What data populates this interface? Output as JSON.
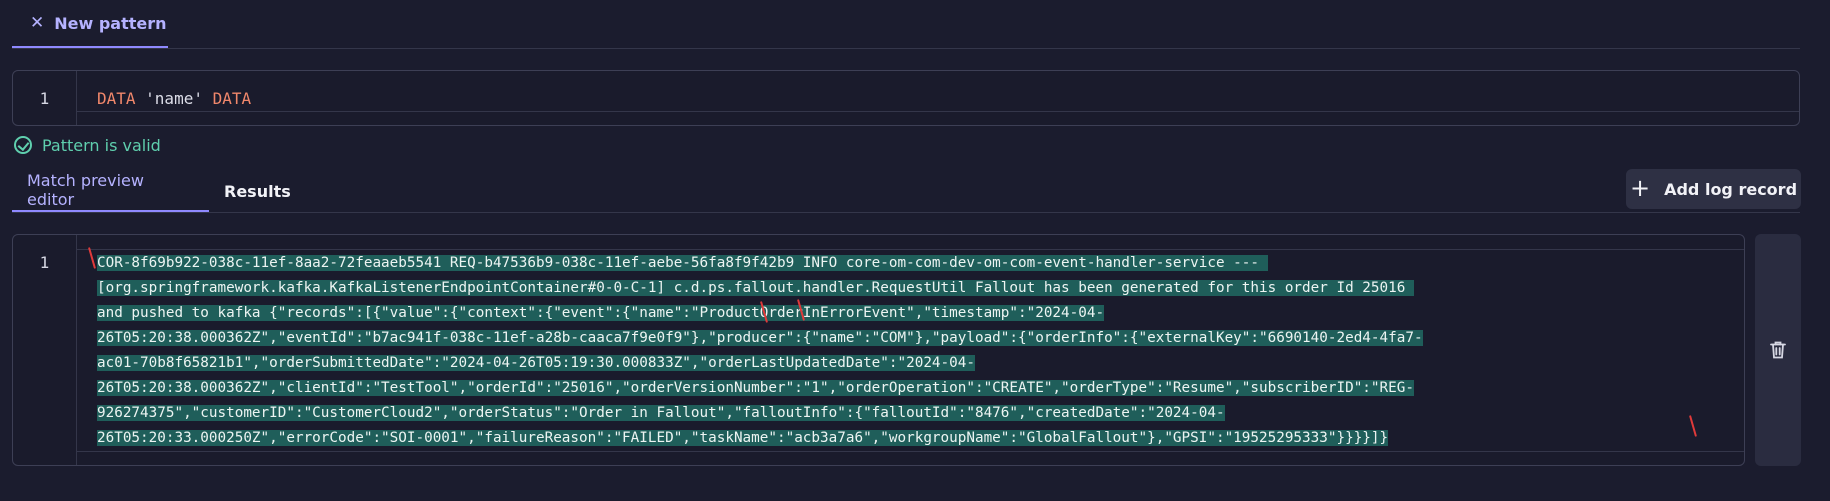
{
  "top_tab": {
    "label": "New pattern"
  },
  "pattern_editor": {
    "line_number": "1",
    "tokens": [
      "DATA",
      " 'name' ",
      "DATA"
    ]
  },
  "status": {
    "text": "Pattern is valid"
  },
  "tabs": [
    {
      "label": "Match preview editor",
      "active": true
    },
    {
      "label": "Results",
      "active": false
    }
  ],
  "add_log_record": {
    "label": "Add log record"
  },
  "log_editor": {
    "line_number": "1",
    "lines": [
      "COR-8f69b922-038c-11ef-8aa2-72feaaeb5541 REQ-b47536b9-038c-11ef-aebe-56fa8f9f42b9 INFO core-om-com-dev-om-com-event-handler-service --- ",
      "[org.springframework.kafka.KafkaListenerEndpointContainer#0-0-C-1] c.d.ps.fallout.handler.RequestUtil Fallout has been generated for this order Id 25016 ",
      "and pushed to kafka {\"records\":[{\"value\":{\"context\":{\"event\":{\"name\":\"ProductOrderInErrorEvent\",\"timestamp\":\"2024-04-",
      "26T05:20:38.000362Z\",\"eventId\":\"b7ac941f-038c-11ef-a28b-caaca7f9e0f9\"},\"producer\":{\"name\":\"COM\"},\"payload\":{\"orderInfo\":{\"externalKey\":\"6690140-2ed4-4fa7-",
      "ac01-70b8f65821b1\",\"orderSubmittedDate\":\"2024-04-26T05:19:30.000833Z\",\"orderLastUpdatedDate\":\"2024-04-",
      "26T05:20:38.000362Z\",\"clientId\":\"TestTool\",\"orderId\":\"25016\",\"orderVersionNumber\":\"1\",\"orderOperation\":\"CREATE\",\"orderType\":\"Resume\",\"subscriberID\":\"REG-",
      "926274375\",\"customerID\":\"CustomerCloud2\",\"orderStatus\":\"Order in Fallout\",\"falloutInfo\":{\"falloutId\":\"8476\",\"createdDate\":\"2024-04-",
      "26T05:20:33.000250Z\",\"errorCode\":\"SOI-0001\",\"failureReason\":\"FAILED\",\"taskName\":\"acb3a7a6\",\"workgroupName\":\"GlobalFallout\"},\"GPSI\":\"19525295333\"}}}}]}"
    ]
  },
  "colors": {
    "accent": "#8f89ff",
    "valid": "#5fcfae",
    "keyword": "#f0876b",
    "selection": "#1f5e5a",
    "marker": "#e03a3a"
  },
  "icons": {
    "close": "close-icon",
    "check": "check-circle-icon",
    "add": "plus-icon",
    "delete": "trash-icon"
  }
}
